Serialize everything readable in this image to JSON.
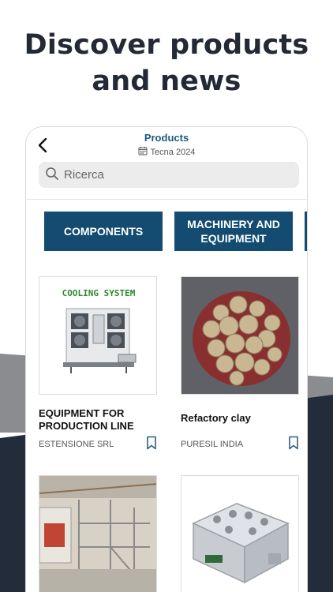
{
  "headline": {
    "line1": "Discover products",
    "line2": "and news"
  },
  "app": {
    "title": "Products",
    "event": "Tecna 2024",
    "search_placeholder": "Ricerca"
  },
  "categories": [
    {
      "label": "COMPONENTS"
    },
    {
      "label": "MACHINERY AND EQUIPMENT"
    }
  ],
  "products": [
    {
      "title": "EQUIPMENT FOR PRODUCTION LINE",
      "company": "ESTENSIONE SRL",
      "image_caption": "COOLING SYSTEM"
    },
    {
      "title": "Refactory  clay",
      "company": "PURESIL INDIA"
    },
    {
      "title": "",
      "company": ""
    },
    {
      "title": "",
      "company": ""
    }
  ],
  "colors": {
    "accent": "#134c70",
    "title": "#1b5a7a",
    "dark_band": "#232c3a",
    "grey_band": "#8a8c8f"
  }
}
